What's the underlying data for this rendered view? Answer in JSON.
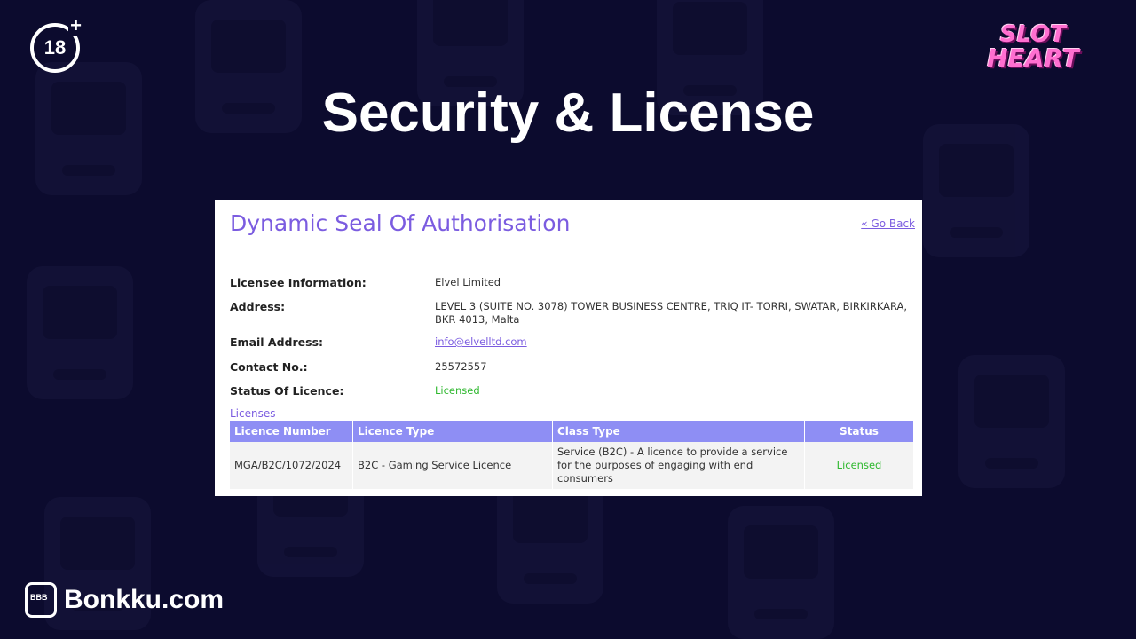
{
  "age_badge": {
    "text": "18",
    "plus": "+"
  },
  "brand_logo": {
    "line1": "SLOT",
    "line2": "HEART"
  },
  "title": "Security & License",
  "panel": {
    "heading": "Dynamic Seal Of Authorisation",
    "go_back": "« Go Back",
    "info": [
      {
        "label": "Licensee Information:",
        "value": "Elvel Limited"
      },
      {
        "label": "Address:",
        "value": "LEVEL 3 (SUITE NO. 3078) TOWER BUSINESS CENTRE, TRIQ IT- TORRI, SWATAR, BIRKIRKARA, BKR 4013, Malta"
      },
      {
        "label": "Email Address:",
        "value": "info@elvelltd.com"
      },
      {
        "label": "Contact No.:",
        "value": "25572557"
      },
      {
        "label": "Status Of Licence:",
        "value": "Licensed"
      }
    ],
    "licenses_label": "Licenses",
    "table": {
      "headers": [
        "Licence Number",
        "Licence Type",
        "Class Type",
        "Status"
      ],
      "rows": [
        [
          "MGA/B2C/1072/2024",
          "B2C - Gaming Service Licence",
          "Service (B2C) - A licence to provide a service for the purposes of engaging with end consumers",
          "Licensed"
        ]
      ]
    }
  },
  "footer": {
    "brand": "Bonkku.com"
  },
  "colors": {
    "background": "#0c0b2e",
    "accent_purple": "#7b5ce0",
    "table_header": "#8e8ef4",
    "status_green": "#2fb82f"
  }
}
